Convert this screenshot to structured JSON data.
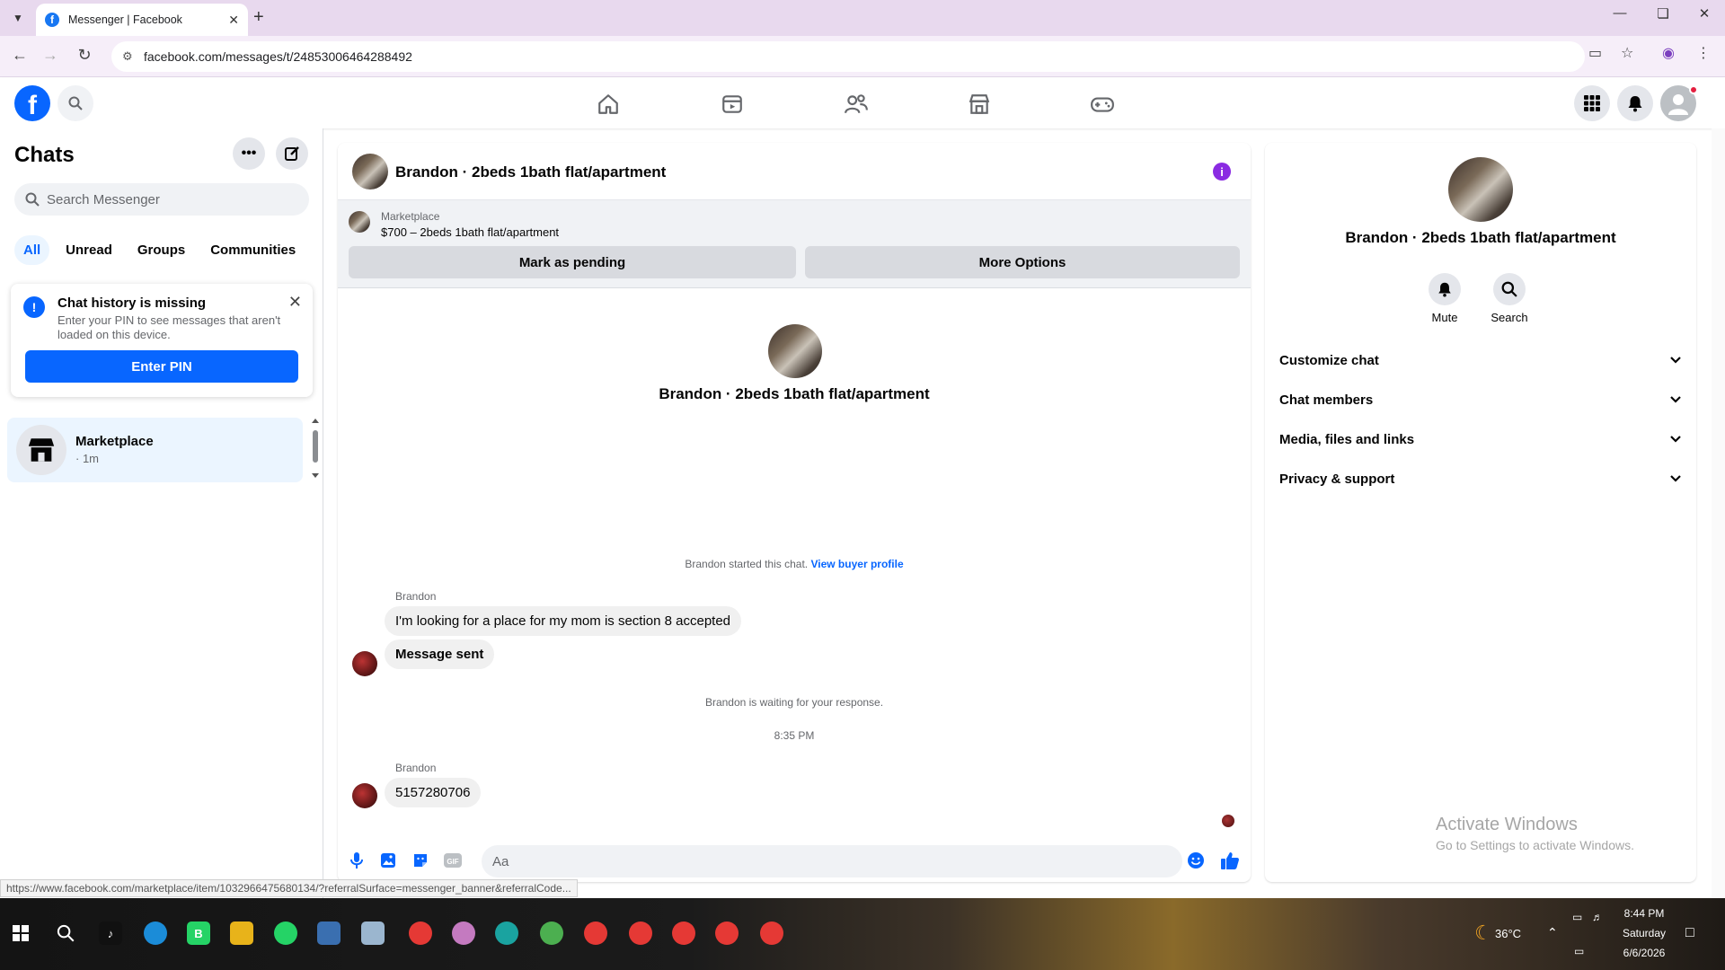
{
  "browser": {
    "tab_title": "Messenger | Facebook",
    "url": "facebook.com/messages/t/24853006464288492",
    "status_url": "https://www.facebook.com/marketplace/item/1032966475680134/?referralSurface=messenger_banner&referralCode..."
  },
  "sidebar": {
    "title": "Chats",
    "search_placeholder": "Search Messenger",
    "filters": [
      "All",
      "Unread",
      "Groups",
      "Communities"
    ],
    "notice": {
      "title": "Chat history is missing",
      "body": "Enter your PIN to see messages that aren't loaded on this device.",
      "button": "Enter PIN"
    },
    "chats": [
      {
        "name": "Marketplace",
        "time": "· 1m"
      }
    ]
  },
  "conversation": {
    "header_name": "Brandon · 2beds 1bath flat/apartment",
    "banner": {
      "label": "Marketplace",
      "item": "$700 – 2beds 1bath flat/apartment",
      "pending_button": "Mark as pending",
      "options_button": "More Options"
    },
    "intro_name": "Brandon · 2beds 1bath flat/apartment",
    "started_text": "Brandon started this chat.",
    "profile_link": "View buyer profile",
    "sender1": "Brandon",
    "msg1": "I'm looking for a place for my mom is section 8 accepted",
    "msg2": "Message sent",
    "waiting_text": "Brandon is waiting for your response.",
    "time_divider": "8:35 PM",
    "sender2": "Brandon",
    "msg3": "5157280706",
    "composer_placeholder": "Aa"
  },
  "right_panel": {
    "name": "Brandon · 2beds 1bath flat/apartment",
    "mute_label": "Mute",
    "search_label": "Search",
    "sections": [
      "Customize chat",
      "Chat members",
      "Media, files and links",
      "Privacy & support"
    ],
    "activate_title": "Activate Windows",
    "activate_sub": "Go to Settings to activate Windows."
  },
  "taskbar": {
    "weather": "36°C",
    "time": "8:44 PM",
    "day": "Saturday",
    "date": "6/6/2026"
  },
  "colors": {
    "facebook_blue": "#0866ff",
    "info_purple": "#8a2be2",
    "active_chat_bg": "#ebf5ff"
  }
}
